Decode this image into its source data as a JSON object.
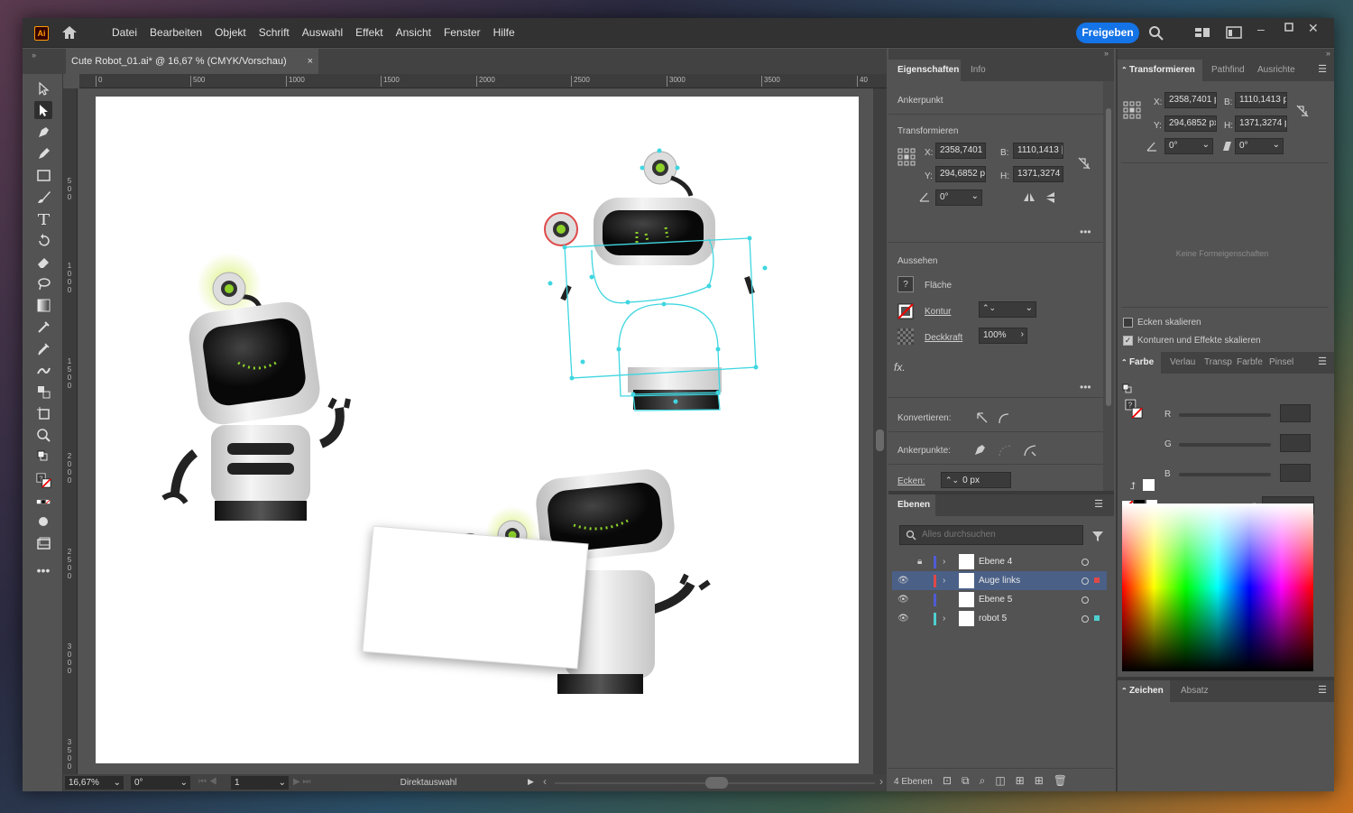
{
  "menubar": {
    "logo": "Ai",
    "items": [
      "Datei",
      "Bearbeiten",
      "Objekt",
      "Schrift",
      "Auswahl",
      "Effekt",
      "Ansicht",
      "Fenster",
      "Hilfe"
    ],
    "share": "Freigeben"
  },
  "document": {
    "tab": "Cute Robot_01.ai* @ 16,67 % (CMYK/Vorschau)",
    "close": "×"
  },
  "ruler": {
    "h": [
      "0",
      "500",
      "1000",
      "1500",
      "2000",
      "2500",
      "3000",
      "3500",
      "40"
    ],
    "v": [
      "5\n0\n0",
      "1\n0\n0\n0",
      "1\n5\n0\n0",
      "2\n0\n0\n0",
      "2\n5\n0\n0",
      "3\n0\n0\n0",
      "3\n5\n0\n0"
    ]
  },
  "status": {
    "zoom": "16,67%",
    "rotation": "0°",
    "artboard": "1",
    "tool": "Direktauswahl"
  },
  "properties": {
    "tabs": [
      "Eigenschaften",
      "Info"
    ],
    "anchor": "Ankerpunkt",
    "transform_title": "Transformieren",
    "x_label": "X:",
    "x": "2358,7401 |",
    "w_label": "B:",
    "w": "1110,1413 |",
    "y_label": "Y:",
    "y": "294,6852 p",
    "h_label": "H:",
    "h": "1371,3274 |",
    "angle": "0°",
    "appearance_title": "Aussehen",
    "fill": "Fläche",
    "stroke": "Kontur",
    "opacity_label": "Deckkraft",
    "opacity": "100%",
    "fx": "fx.",
    "convert": "Konvertieren:",
    "anchors": "Ankerpunkte:",
    "corners": "Ecken:",
    "corners_val": "0 px"
  },
  "layers": {
    "tab": "Ebenen",
    "search_placeholder": "Alles durchsuchen",
    "rows": [
      {
        "name": "Ebene 4",
        "color": "#4f5bd5"
      },
      {
        "name": "Auge links",
        "color": "#e04848"
      },
      {
        "name": "Ebene 5",
        "color": "#4f5bd5"
      },
      {
        "name": "robot 5",
        "color": "#4fd0d0"
      }
    ],
    "count": "4 Ebenen"
  },
  "transform_panel": {
    "tabs": [
      "Transformieren",
      "Pathfind",
      "Ausrichte"
    ],
    "x_label": "X:",
    "x": "2358,7401 p",
    "w_label": "B:",
    "w": "1110,1413 p",
    "y_label": "Y:",
    "y": "294,6852 px",
    "h_label": "H:",
    "h": "1371,3274 p",
    "angle": "0°",
    "shear": "0°",
    "no_shape": "Keine Formeigenschaften",
    "scale_corners": "Ecken skalieren",
    "scale_strokes": "Konturen und Effekte skalieren"
  },
  "color_panel": {
    "tabs": [
      "Farbe",
      "Verlau",
      "Transp",
      "Farbfe",
      "Pinsel"
    ],
    "r": "R",
    "g": "G",
    "b": "B",
    "hash": "#"
  },
  "char_panel": {
    "tabs": [
      "Zeichen",
      "Absatz"
    ]
  }
}
